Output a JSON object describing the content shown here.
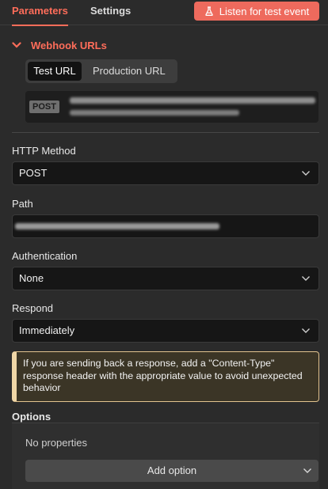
{
  "tabs": {
    "parameters": "Parameters",
    "settings": "Settings"
  },
  "listen_button": {
    "label": "Listen for test event",
    "icon": "flask-icon",
    "color": "#ee6a5d"
  },
  "webhook": {
    "section_title": "Webhook URLs",
    "toggle": {
      "test": "Test URL",
      "production": "Production URL",
      "selected": "Test URL"
    },
    "method_badge": "POST"
  },
  "fields": {
    "http_method": {
      "label": "HTTP Method",
      "value": "POST"
    },
    "path": {
      "label": "Path"
    },
    "authentication": {
      "label": "Authentication",
      "value": "None"
    },
    "respond": {
      "label": "Respond",
      "value": "Immediately"
    }
  },
  "notice": {
    "text": "If you are sending back a response, add a \"Content-Type\" response header with the appropriate value to avoid unexpected behavior"
  },
  "options": {
    "label": "Options",
    "empty_text": "No properties",
    "add_button": "Add option"
  },
  "colors": {
    "accent": "#ff6d5a",
    "background": "#2b2b2b",
    "notice_border": "#e2c38f"
  }
}
